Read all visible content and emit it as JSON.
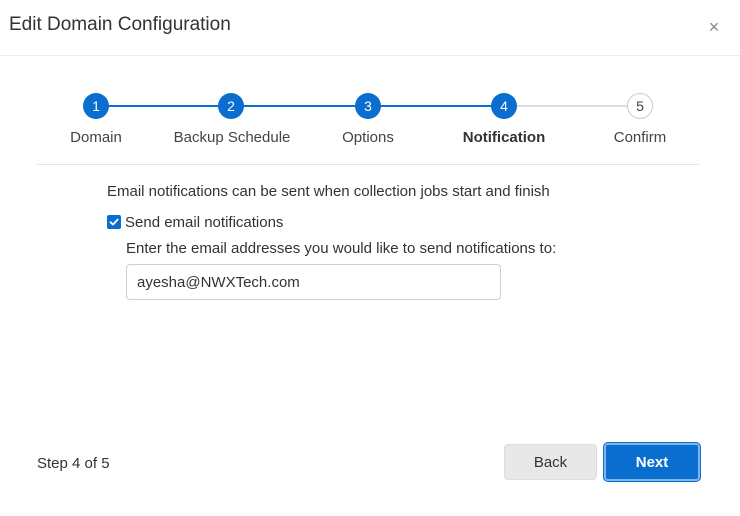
{
  "dialog": {
    "title": "Edit Domain Configuration",
    "close_icon": "close-icon",
    "close_glyph": "×"
  },
  "stepper": {
    "current_step": 4,
    "steps": [
      {
        "number": "1",
        "label": "Domain",
        "state": "complete"
      },
      {
        "number": "2",
        "label": "Backup Schedule",
        "state": "complete"
      },
      {
        "number": "3",
        "label": "Options",
        "state": "complete"
      },
      {
        "number": "4",
        "label": "Notification",
        "state": "current"
      },
      {
        "number": "5",
        "label": "Confirm",
        "state": "upcoming"
      }
    ]
  },
  "notification": {
    "description": "Email notifications can be sent when collection jobs start and finish",
    "send_email_checked": true,
    "send_email_label": "Send email notifications",
    "email_prompt": "Enter the email addresses you would like to send notifications to:",
    "email_value": "ayesha@NWXTech.com"
  },
  "footer": {
    "step_counter": "Step 4 of 5",
    "back_label": "Back",
    "next_label": "Next"
  },
  "colors": {
    "accent": "#0a6ed1",
    "inactive_line": "#dddddd",
    "back_button_bg": "#e8e8e8"
  }
}
